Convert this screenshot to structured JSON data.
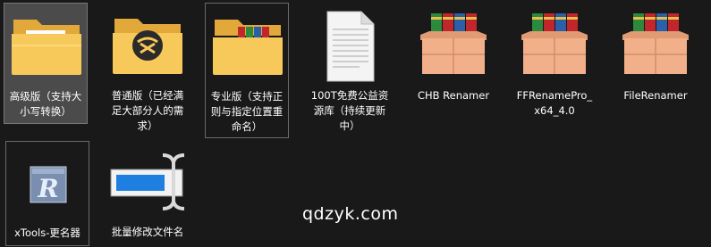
{
  "colors": {
    "background": "#191919",
    "selected": "#4b4b4b",
    "folder": "#f6c95a",
    "folder_dark": "#e2a93a",
    "box": "#f2b08a",
    "book_red": "#c0272d",
    "book_blue": "#2b5fa8",
    "book_green": "#2c8a3c"
  },
  "files": [
    {
      "id": "f1",
      "label": "高级版（支持大小写转换）",
      "icon": "folder-preview-icon",
      "state": "selected"
    },
    {
      "id": "f2",
      "label": "普通版（已经满足大部分人的需求）",
      "icon": "folder-logo-icon",
      "state": "normal"
    },
    {
      "id": "f3",
      "label": "专业版（支持正则与指定位置重命名）",
      "icon": "folder-books-icon",
      "state": "focused"
    },
    {
      "id": "f4",
      "label": "100T免费公益资源库（持续更新中）",
      "icon": "text-document-icon",
      "state": "normal"
    },
    {
      "id": "f5",
      "label": "CHB Renamer",
      "icon": "installer-box-icon",
      "state": "normal"
    },
    {
      "id": "f6",
      "label": "FFRenamePro_x64_4.0",
      "icon": "installer-box-icon",
      "state": "normal"
    },
    {
      "id": "f7",
      "label": "FileRenamer",
      "icon": "installer-box-icon",
      "state": "normal"
    },
    {
      "id": "f8",
      "label": "xTools-更名器",
      "icon": "xtools-app-icon",
      "state": "focused"
    },
    {
      "id": "f9",
      "label": "批量修改文件名",
      "icon": "rename-app-icon",
      "state": "normal"
    }
  ],
  "watermark": "qdzyk.com"
}
